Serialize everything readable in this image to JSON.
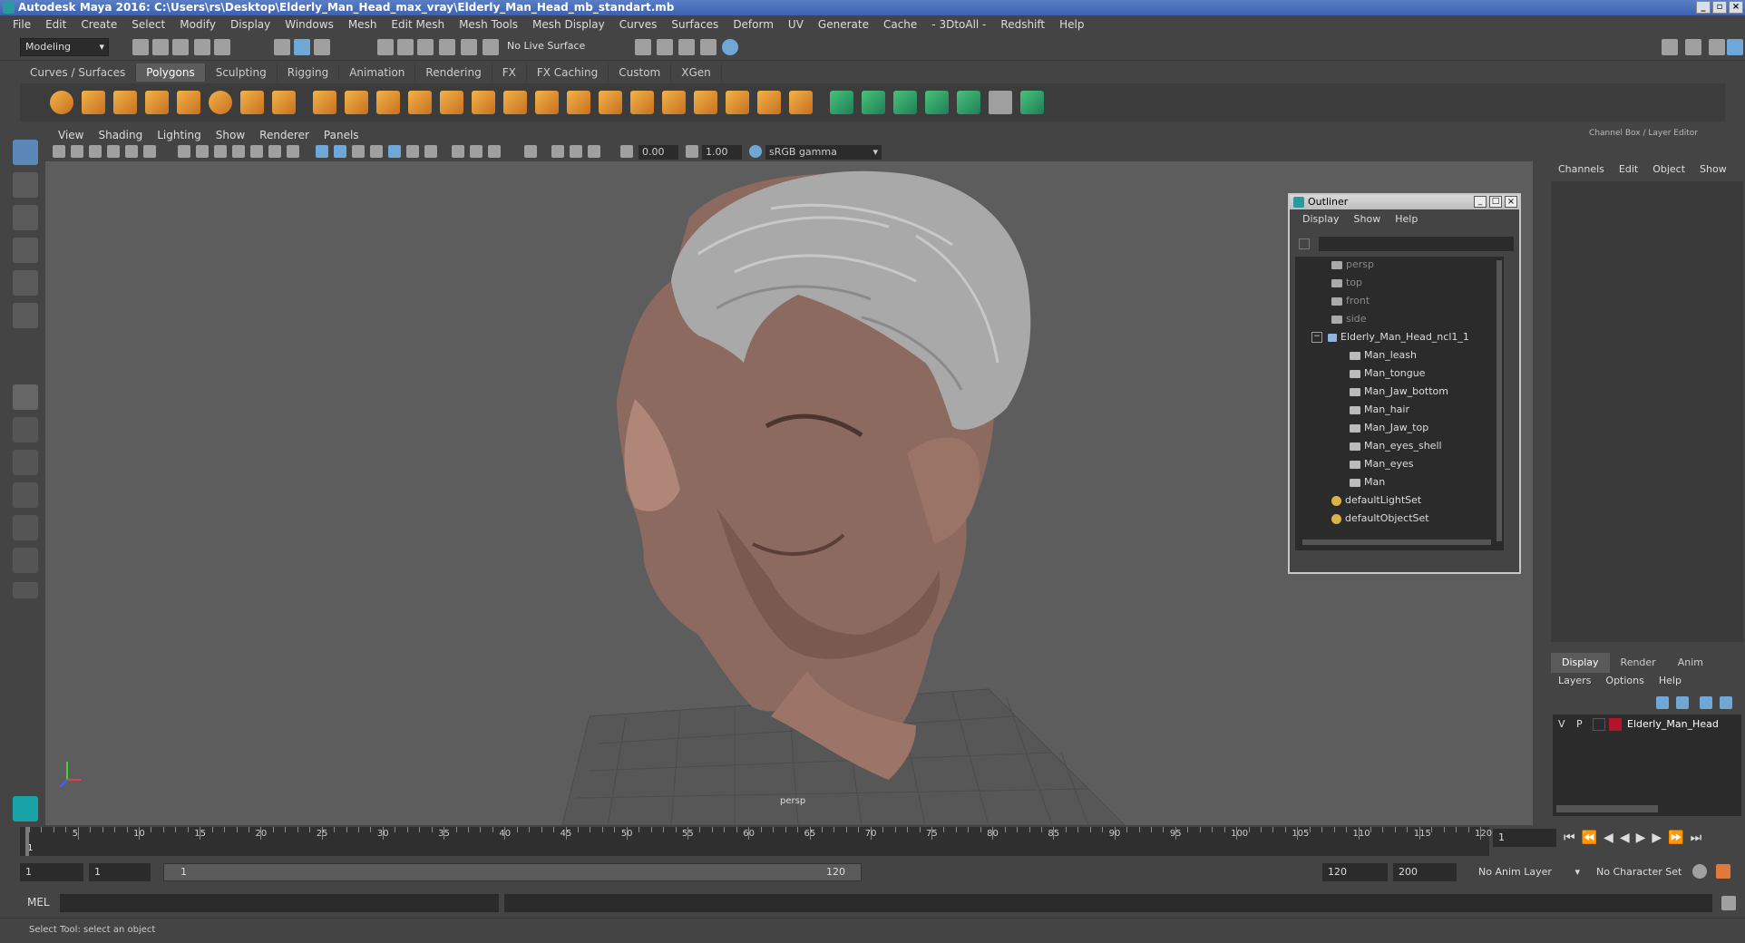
{
  "title": "Autodesk Maya 2016: C:\\Users\\rs\\Desktop\\Elderly_Man_Head_max_vray\\Elderly_Man_Head_mb_standart.mb",
  "menu": [
    "File",
    "Edit",
    "Create",
    "Select",
    "Modify",
    "Display",
    "Windows",
    "Mesh",
    "Edit Mesh",
    "Mesh Tools",
    "Mesh Display",
    "Curves",
    "Surfaces",
    "Deform",
    "UV",
    "Generate",
    "Cache",
    "- 3DtoAll -",
    "Redshift",
    "Help"
  ],
  "status": {
    "mode": "Modeling",
    "live_surface": "No Live Surface"
  },
  "shelf_tabs": [
    "Curves / Surfaces",
    "Polygons",
    "Sculpting",
    "Rigging",
    "Animation",
    "Rendering",
    "FX",
    "FX Caching",
    "Custom",
    "XGen"
  ],
  "shelf_active": "Polygons",
  "viewport": {
    "menu": [
      "View",
      "Shading",
      "Lighting",
      "Show",
      "Renderer",
      "Panels"
    ],
    "exposure": "0.00",
    "gamma": "1.00",
    "color_space": "sRGB gamma",
    "camera_label": "persp"
  },
  "outliner": {
    "title": "Outliner",
    "menu": [
      "Display",
      "Show",
      "Help"
    ],
    "items": [
      {
        "label": "persp",
        "type": "camera"
      },
      {
        "label": "top",
        "type": "camera"
      },
      {
        "label": "front",
        "type": "camera"
      },
      {
        "label": "side",
        "type": "camera"
      },
      {
        "label": "Elderly_Man_Head_ncl1_1",
        "type": "group"
      },
      {
        "label": "Man_leash",
        "type": "mesh"
      },
      {
        "label": "Man_tongue",
        "type": "mesh"
      },
      {
        "label": "Man_Jaw_bottom",
        "type": "mesh"
      },
      {
        "label": "Man_hair",
        "type": "mesh"
      },
      {
        "label": "Man_Jaw_top",
        "type": "mesh"
      },
      {
        "label": "Man_eyes_shell",
        "type": "mesh"
      },
      {
        "label": "Man_eyes",
        "type": "mesh"
      },
      {
        "label": "Man",
        "type": "mesh"
      },
      {
        "label": "defaultLightSet",
        "type": "set"
      },
      {
        "label": "defaultObjectSet",
        "type": "set"
      }
    ]
  },
  "channel_box": {
    "title": "Channel Box / Layer Editor",
    "menu": [
      "Channels",
      "Edit",
      "Object",
      "Show"
    ]
  },
  "layer_editor": {
    "tabs": [
      "Display",
      "Render",
      "Anim"
    ],
    "active_tab": "Display",
    "menu": [
      "Layers",
      "Options",
      "Help"
    ],
    "layer": {
      "v": "V",
      "p": "P",
      "name": "Elderly_Man_Head",
      "color": "#b3142c"
    }
  },
  "timeline": {
    "ticks": [
      "5",
      "10",
      "15",
      "20",
      "25",
      "30",
      "35",
      "40",
      "45",
      "50",
      "55",
      "60",
      "65",
      "70",
      "75",
      "80",
      "85",
      "90",
      "95",
      "100",
      "105",
      "110",
      "115",
      "120"
    ],
    "start_label": "1",
    "current_frame": "1"
  },
  "range": {
    "start": "1",
    "playback_start": "1",
    "slider_start": "1",
    "slider_end": "120",
    "playback_end": "120",
    "end": "200",
    "anim_layer": "No Anim Layer",
    "character_set": "No Character Set"
  },
  "command_line": {
    "label": "MEL"
  },
  "help_line": "Select Tool: select an object"
}
